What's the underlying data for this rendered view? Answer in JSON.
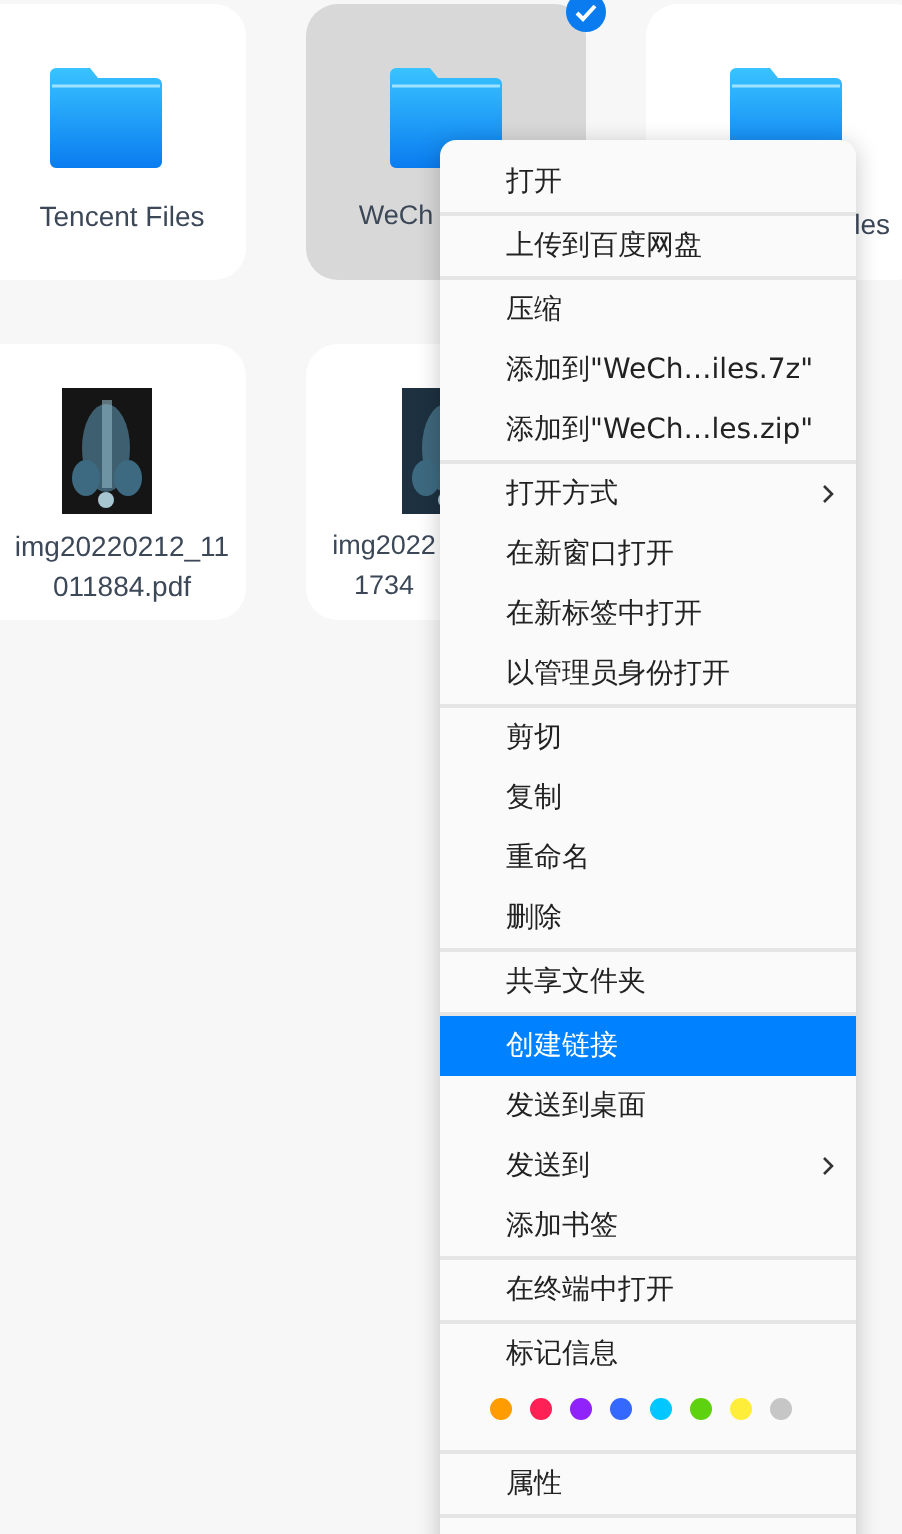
{
  "files": [
    {
      "label": "Tencent Files",
      "kind": "folder",
      "selected": false
    },
    {
      "label": "WeCh",
      "kind": "folder",
      "selected": true
    },
    {
      "label": "les",
      "kind": "folder",
      "selected": false
    },
    {
      "label": "img20220212_11 011884.pdf",
      "kind": "picture",
      "selected": false
    },
    {
      "label": "img2022 1734",
      "kind": "picture",
      "selected": false
    }
  ],
  "context_menu": {
    "groups": [
      {
        "items": [
          {
            "label": "打开",
            "submenu": false,
            "selected": false
          }
        ]
      },
      {
        "items": [
          {
            "label": "上传到百度网盘",
            "submenu": false,
            "selected": false
          }
        ]
      },
      {
        "items": [
          {
            "label": "压缩",
            "submenu": false,
            "selected": false
          },
          {
            "label": "添加到\"WeCh…iles.7z\"",
            "submenu": false,
            "selected": false
          },
          {
            "label": "添加到\"WeCh…les.zip\"",
            "submenu": false,
            "selected": false
          }
        ]
      },
      {
        "items": [
          {
            "label": "打开方式",
            "submenu": true,
            "selected": false
          },
          {
            "label": "在新窗口打开",
            "submenu": false,
            "selected": false
          },
          {
            "label": "在新标签中打开",
            "submenu": false,
            "selected": false
          },
          {
            "label": "以管理员身份打开",
            "submenu": false,
            "selected": false
          }
        ]
      },
      {
        "items": [
          {
            "label": "剪切",
            "submenu": false,
            "selected": false
          },
          {
            "label": "复制",
            "submenu": false,
            "selected": false
          },
          {
            "label": "重命名",
            "submenu": false,
            "selected": false
          },
          {
            "label": "删除",
            "submenu": false,
            "selected": false
          }
        ]
      },
      {
        "items": [
          {
            "label": "共享文件夹",
            "submenu": false,
            "selected": false
          }
        ]
      },
      {
        "items": [
          {
            "label": "创建链接",
            "submenu": false,
            "selected": true
          },
          {
            "label": "发送到桌面",
            "submenu": false,
            "selected": false
          },
          {
            "label": "发送到",
            "submenu": true,
            "selected": false
          },
          {
            "label": "添加书签",
            "submenu": false,
            "selected": false
          }
        ]
      },
      {
        "items": [
          {
            "label": "在终端中打开",
            "submenu": false,
            "selected": false
          }
        ]
      },
      {
        "title": "标记信息",
        "colors": [
          {
            "color": "#ff9c00"
          },
          {
            "color": "#ff2056"
          },
          {
            "color": "#9023fc"
          },
          {
            "color": "#3468ff"
          },
          {
            "color": "#00c7ff"
          },
          {
            "color": "#5fd20f"
          },
          {
            "color": "#ffee39"
          },
          {
            "color": "#c6c6c6"
          }
        ]
      },
      {
        "items": [
          {
            "label": "属性",
            "submenu": false,
            "selected": false
          }
        ]
      }
    ]
  }
}
